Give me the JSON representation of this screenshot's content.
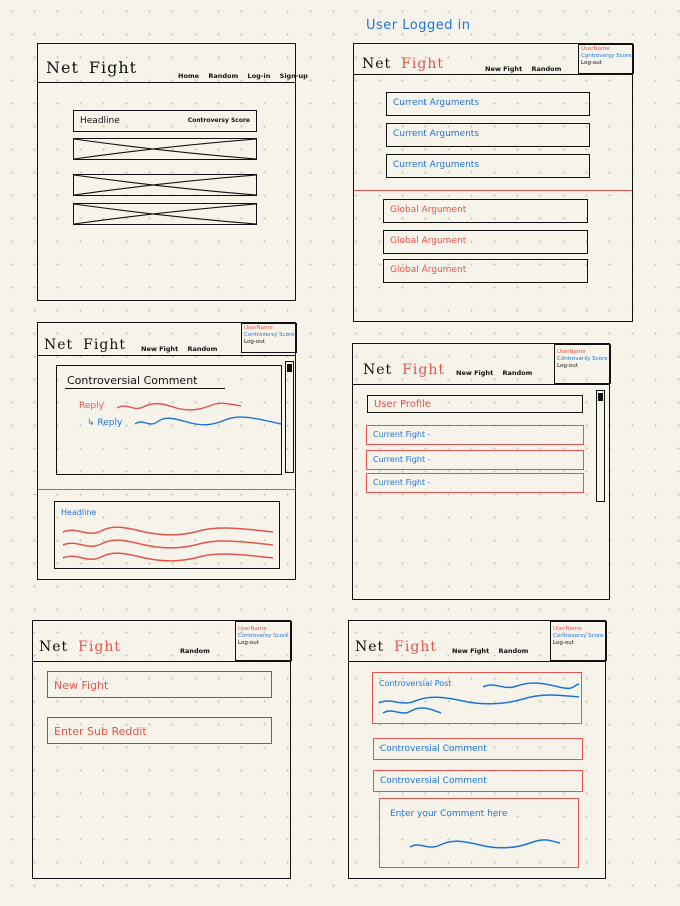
{
  "caption": "User Logged in",
  "logo": {
    "net": "Net",
    "fight": "Fight"
  },
  "frame1": {
    "nav": [
      "Home",
      "Random",
      "Log-in",
      "Sign-up"
    ],
    "headline": "Headline",
    "score": "Controversy Score"
  },
  "frame2": {
    "nav": [
      "New Fight",
      "Random",
      "Log-out"
    ],
    "user": {
      "name": "UserName",
      "score": "Controversy Score",
      "logout": "Log-out"
    },
    "current": [
      "Current Arguments",
      "Current Arguments",
      "Current Arguments"
    ],
    "global": [
      "Global Argument",
      "Global Argument",
      "Global Argument"
    ]
  },
  "frame3": {
    "nav": [
      "New Fight",
      "Random"
    ],
    "user": {
      "name": "UserName",
      "score": "Controversy Score",
      "logout": "Log-out"
    },
    "comment_title": "Controversial Comment",
    "reply": "Reply",
    "sub_reply": "↳ Reply",
    "headline": "Headline"
  },
  "frame4": {
    "nav": [
      "New Fight",
      "Random"
    ],
    "user": {
      "name": "UserName",
      "score": "Controversy Score",
      "logout": "Log-out"
    },
    "profile": "User Profile",
    "fights": [
      "Current Fight -",
      "Current Fight -",
      "Current Fight -"
    ]
  },
  "frame5": {
    "nav": [
      "Random"
    ],
    "user": {
      "name": "UserName",
      "score": "Controversy Score",
      "logout": "Log-out"
    },
    "new_fight": "New Fight",
    "subreddit": "Enter Sub Reddit"
  },
  "frame6": {
    "nav": [
      "New Fight",
      "Random"
    ],
    "user": {
      "name": "UserName",
      "score": "Controversy Score",
      "logout": "Log-out"
    },
    "post": "Controversial Post",
    "comments": [
      "Controversial Comment",
      "Controversial Comment"
    ],
    "enter_comment": "Enter your Comment here"
  },
  "colors": {
    "ink": "#111111",
    "blue": "#1e73d8",
    "red": "#e5534b",
    "paper": "#f6f4ea"
  }
}
